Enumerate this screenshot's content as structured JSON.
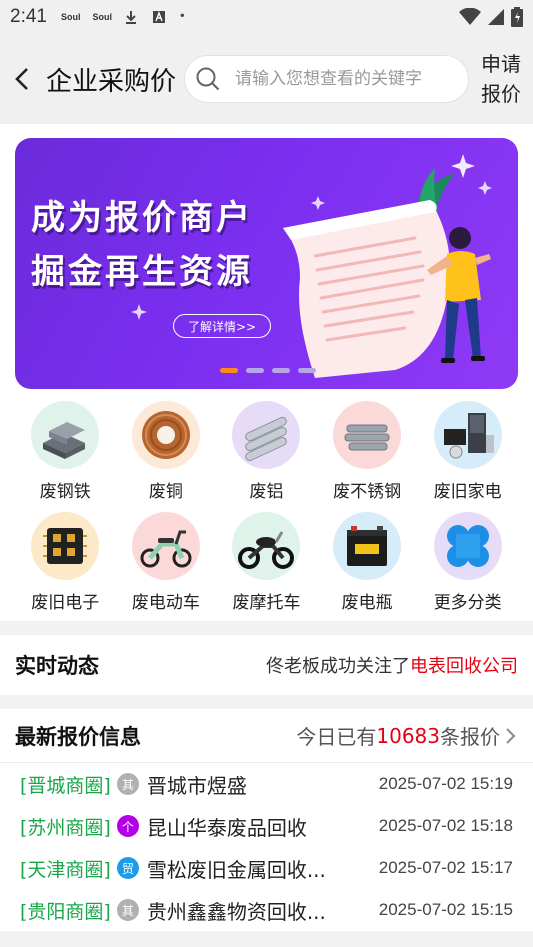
{
  "status_bar": {
    "time": "2:41",
    "app1": "Soul",
    "app2": "Soul"
  },
  "header": {
    "title": "企业采购价",
    "search_placeholder": "请输入您想查看的关键字",
    "apply_line1": "申请",
    "apply_line2": "报价"
  },
  "banner": {
    "line1": "成为报价商户",
    "line2": "掘金再生资源",
    "button": "了解详情>>",
    "active_slide": 1,
    "slide_count": 4
  },
  "categories": [
    {
      "label": "废钢铁",
      "icon": "steel-icon"
    },
    {
      "label": "废铜",
      "icon": "copper-coil-icon"
    },
    {
      "label": "废铝",
      "icon": "aluminum-bars-icon"
    },
    {
      "label": "废不锈钢",
      "icon": "stainless-steel-icon"
    },
    {
      "label": "废旧家电",
      "icon": "appliances-icon"
    },
    {
      "label": "废旧电子",
      "icon": "chip-icon"
    },
    {
      "label": "废电动车",
      "icon": "ebike-icon"
    },
    {
      "label": "废摩托车",
      "icon": "motorcycle-icon"
    },
    {
      "label": "废电瓶",
      "icon": "battery-icon"
    },
    {
      "label": "更多分类",
      "icon": "more-categories-icon"
    }
  ],
  "live": {
    "title": "实时动态",
    "text_prefix": "佟老板成功关注了",
    "text_highlight": "电表回收公司"
  },
  "quotes": {
    "title": "最新报价信息",
    "count_prefix": "今日已有",
    "count": "10683",
    "count_suffix": "条报价",
    "rows": [
      {
        "circle": "[晋城商圈]",
        "badge": "其",
        "badge_color": "#b0b0b0",
        "name": "晋城市煜盛",
        "time": "2025-07-02 15:19"
      },
      {
        "circle": "[苏州商圈]",
        "badge": "个",
        "badge_color": "#b400e6",
        "name": "昆山华泰废品回收",
        "time": "2025-07-02 15:18"
      },
      {
        "circle": "[天津商圈]",
        "badge": "贸",
        "badge_color": "#1e9be8",
        "name": "雪松废旧金属回收...",
        "time": "2025-07-02 15:17"
      },
      {
        "circle": "[贵阳商圈]",
        "badge": "其",
        "badge_color": "#b0b0b0",
        "name": "贵州鑫鑫物资回收...",
        "time": "2025-07-02 15:15"
      }
    ]
  }
}
